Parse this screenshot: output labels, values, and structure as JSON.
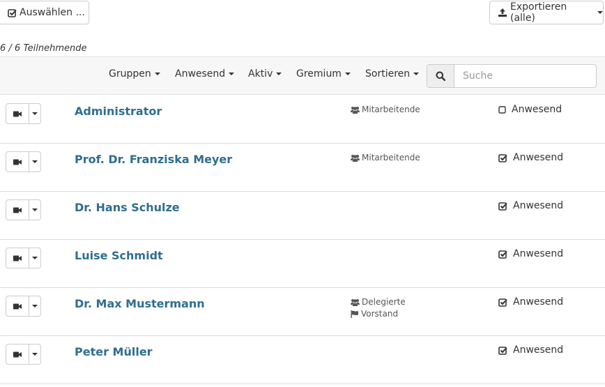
{
  "toolbar": {
    "select_label": "Auswählen ...",
    "export_label": "Exportieren (alle)",
    "count_text": "6 / 6 Teilnehmende",
    "filters": [
      "Gruppen",
      "Anwesend",
      "Aktiv",
      "Gremium",
      "Sortieren"
    ],
    "search_placeholder": "Suche"
  },
  "participants": [
    {
      "name": "Administrator",
      "groups": [
        "Mitarbeitende"
      ],
      "flags": [],
      "presence_label": "Anwesend",
      "present": false
    },
    {
      "name": "Prof. Dr. Franziska Meyer",
      "groups": [
        "Mitarbeitende"
      ],
      "flags": [],
      "presence_label": "Anwesend",
      "present": true
    },
    {
      "name": "Dr. Hans Schulze",
      "groups": [],
      "flags": [],
      "presence_label": "Anwesend",
      "present": true
    },
    {
      "name": "Luise Schmidt",
      "groups": [],
      "flags": [],
      "presence_label": "Anwesend",
      "present": true
    },
    {
      "name": "Dr. Max Mustermann",
      "groups": [
        "Delegierte"
      ],
      "flags": [
        "Vorstand"
      ],
      "presence_label": "Anwesend",
      "present": true
    },
    {
      "name": "Peter Müller",
      "groups": [],
      "flags": [],
      "presence_label": "Anwesend",
      "present": true
    }
  ]
}
